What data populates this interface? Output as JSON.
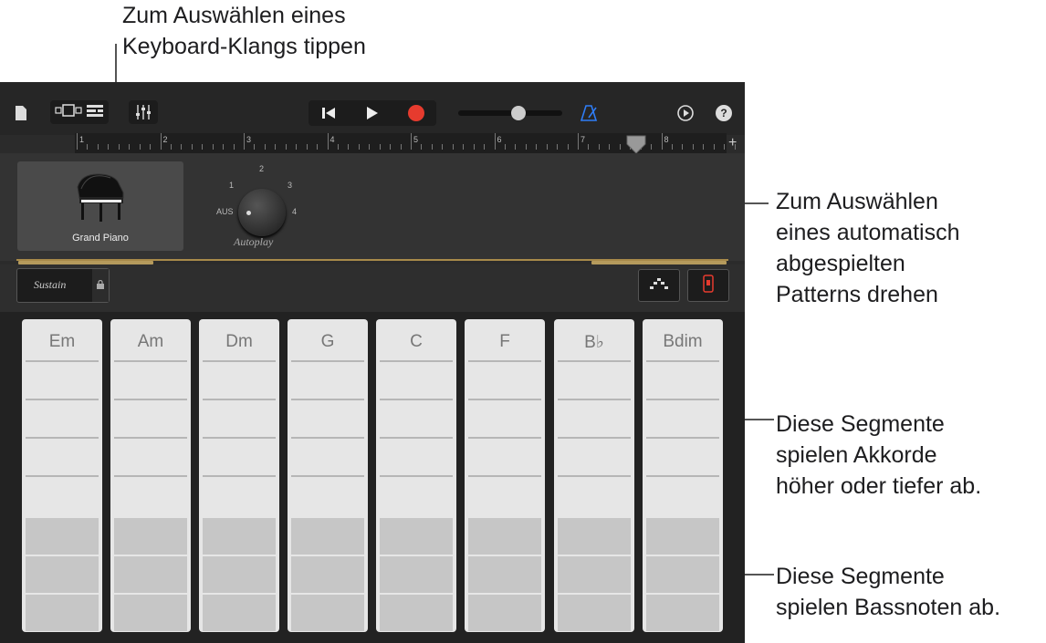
{
  "callouts": {
    "keyboard_sound": "Zum Auswählen eines\nKeyboard-Klangs tippen",
    "autoplay": "Zum Auswählen\neines automatisch\nabgespielten\nPatterns drehen",
    "chord_segments": "Diese Segmente\nspielen Akkorde\nhöher oder tiefer ab.",
    "bass_segments": "Diese Segmente\nspielen Bassnoten ab."
  },
  "instrument": {
    "name": "Grand Piano"
  },
  "ruler": {
    "bars": [
      "1",
      "2",
      "3",
      "4",
      "5",
      "6",
      "7",
      "8"
    ]
  },
  "autoplay": {
    "label": "Autoplay",
    "positions": {
      "off": "AUS",
      "p1": "1",
      "p2": "2",
      "p3": "3",
      "p4": "4"
    }
  },
  "sustain": {
    "label": "Sustain"
  },
  "chords": [
    "Em",
    "Am",
    "Dm",
    "G",
    "C",
    "F",
    "B♭",
    "Bdim"
  ],
  "colors": {
    "record": "#e63b2e",
    "metronome": "#2f7df6",
    "accent_gold": "#b59a5c"
  },
  "icons": [
    "document-icon",
    "view-toggle-icon",
    "tracks-icon",
    "mixer-icon",
    "rewind-icon",
    "play-icon",
    "record-icon",
    "metronome-icon",
    "settings-icon",
    "help-icon",
    "lock-icon",
    "arpeggiator-icon",
    "remote-icon"
  ]
}
